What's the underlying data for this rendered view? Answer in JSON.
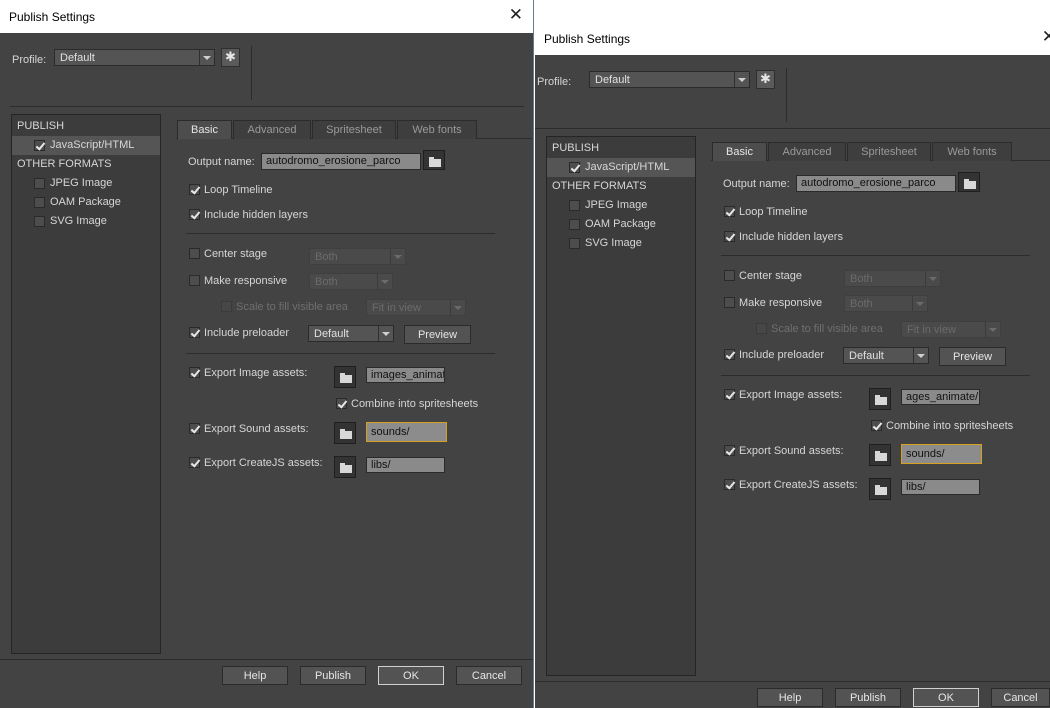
{
  "dialog": {
    "title": "Publish Settings",
    "close_glyph": "✕",
    "profile_label": "Profile:",
    "profile_value": "Default"
  },
  "sidebar": {
    "publish_header": "PUBLISH",
    "other_header": "OTHER FORMATS",
    "items": [
      {
        "label": "JavaScript/HTML",
        "checked": true
      },
      {
        "label": "JPEG Image",
        "checked": false
      },
      {
        "label": "OAM Package",
        "checked": false
      },
      {
        "label": "SVG Image",
        "checked": false
      }
    ]
  },
  "tabs": [
    "Basic",
    "Advanced",
    "Spritesheet",
    "Web fonts"
  ],
  "basic": {
    "output_label": "Output name:",
    "output_value": "autodromo_erosione_parco",
    "loop_timeline": "Loop Timeline",
    "include_hidden": "Include hidden layers",
    "center_stage": "Center stage",
    "center_stage_value": "Both",
    "make_responsive": "Make responsive",
    "make_responsive_value": "Both",
    "scale_fill": "Scale to fill visible area",
    "scale_fill_value": "Fit in view",
    "include_preloader": "Include preloader",
    "preloader_value": "Default",
    "preview_button": "Preview",
    "export_image": "Export Image assets:",
    "image_path_1": "images_animate",
    "image_path_2": "ages_animate/",
    "combine": "Combine into spritesheets",
    "export_sound": "Export Sound assets:",
    "sound_path": "sounds/",
    "export_createjs": "Export CreateJS assets:",
    "createjs_path": "libs/"
  },
  "footer": {
    "help": "Help",
    "publish": "Publish",
    "ok": "OK",
    "cancel": "Cancel"
  }
}
